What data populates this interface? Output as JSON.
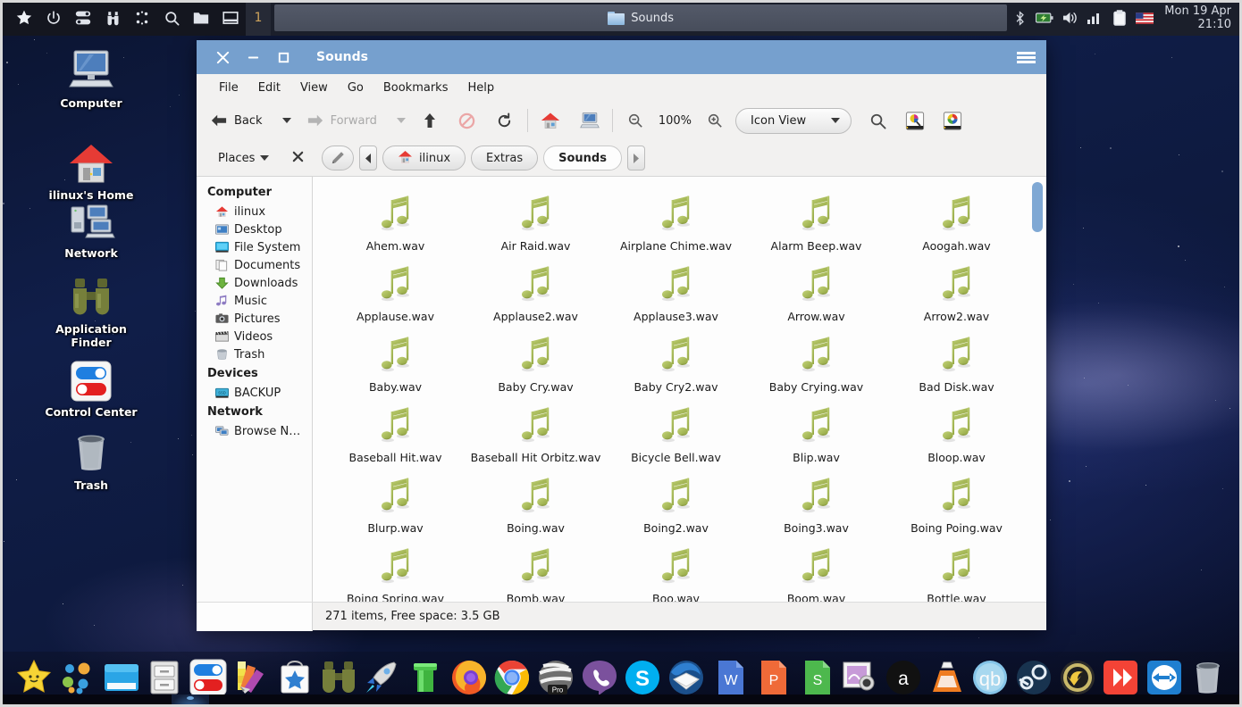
{
  "panel": {
    "launcher_icons": [
      "star-icon",
      "power-icon",
      "toggle-icon",
      "binoculars-icon",
      "apps-grid-icon",
      "search-icon",
      "folder-icon",
      "window-icon"
    ],
    "workspace": "1",
    "taskbar_window": "Sounds",
    "tray_icons": [
      "battery-icon",
      "volume-icon",
      "network-signal-icon",
      "clipboard-icon",
      "flag-us-icon"
    ],
    "clock_date": "Mon 19 Apr",
    "clock_time": "21:10"
  },
  "desktop": {
    "icons": [
      {
        "label": "Computer",
        "icon": "computer-icon"
      },
      {
        "label": "ilinux's Home",
        "icon": "home-icon"
      },
      {
        "label": "Network",
        "icon": "network-icon"
      },
      {
        "label": "Application Finder",
        "icon": "binoculars-icon"
      },
      {
        "label": "Control Center",
        "icon": "control-center-icon"
      },
      {
        "label": "Trash",
        "icon": "trash-icon"
      }
    ]
  },
  "window": {
    "title": "Sounds",
    "close_label": "✕",
    "minimize_label": "─",
    "maximize_label": "□",
    "menus": [
      "File",
      "Edit",
      "View",
      "Go",
      "Bookmarks",
      "Help"
    ],
    "toolbar": {
      "back_label": "Back",
      "forward_label": "Forward",
      "up_icon": "arrow-up-icon",
      "stop_icon": "stop-icon",
      "reload_icon": "reload-icon",
      "home_icon": "home-icon",
      "computer_icon": "computer-icon",
      "zoom_out_icon": "zoom-out-icon",
      "zoom_level": "100%",
      "zoom_in_icon": "zoom-in-icon",
      "view_mode": "Icon View",
      "search_icon": "search-icon",
      "preview_icon": "image-preview-icon",
      "colorpicker_icon": "color-wheel-icon"
    },
    "places_header": {
      "label": "Places",
      "close_icon": "close-panel-icon"
    },
    "pathbar": {
      "edit_icon": "pencil-path-icon",
      "prev_icon": "chevron-left-icon",
      "next_icon": "chevron-right-icon",
      "crumbs": [
        {
          "label": "ilinux",
          "icon": "home-icon",
          "current": false
        },
        {
          "label": "Extras",
          "icon": "",
          "current": false
        },
        {
          "label": "Sounds",
          "icon": "",
          "current": true
        }
      ]
    },
    "sidebar": {
      "groups": [
        {
          "title": "Computer",
          "items": [
            {
              "label": "ilinux",
              "icon": "home-icon"
            },
            {
              "label": "Desktop",
              "icon": "desktop-icon"
            },
            {
              "label": "File System",
              "icon": "drive-icon"
            },
            {
              "label": "Documents",
              "icon": "documents-icon"
            },
            {
              "label": "Downloads",
              "icon": "download-arrow-icon"
            },
            {
              "label": "Music",
              "icon": "music-note-icon"
            },
            {
              "label": "Pictures",
              "icon": "pictures-icon"
            },
            {
              "label": "Videos",
              "icon": "video-clapper-icon"
            },
            {
              "label": "Trash",
              "icon": "trash-icon"
            }
          ]
        },
        {
          "title": "Devices",
          "items": [
            {
              "label": "BACKUP",
              "icon": "ssd-icon"
            }
          ]
        },
        {
          "title": "Network",
          "items": [
            {
              "label": "Browse N…",
              "icon": "network-browse-icon"
            }
          ]
        }
      ]
    },
    "files": [
      "Ahem.wav",
      "Air Raid.wav",
      "Airplane Chime.wav",
      "Alarm Beep.wav",
      "Aoogah.wav",
      "Applause.wav",
      "Applause2.wav",
      "Applause3.wav",
      "Arrow.wav",
      "Arrow2.wav",
      "Baby.wav",
      "Baby Cry.wav",
      "Baby Cry2.wav",
      "Baby Crying.wav",
      "Bad Disk.wav",
      "Baseball Hit.wav",
      "Baseball Hit Orbitz.wav",
      "Bicycle Bell.wav",
      "Blip.wav",
      "Bloop.wav",
      "Blurp.wav",
      "Boing.wav",
      "Boing2.wav",
      "Boing3.wav",
      "Boing Poing.wav",
      "Boing Spring.wav",
      "Bomb.wav",
      "Boo.wav",
      "Boom.wav",
      "Bottle.wav"
    ],
    "file_icon": "music-note-icon",
    "statusbar": "271 items, Free space: 3.5 GB"
  },
  "dock": {
    "items": [
      "whisker-star-icon",
      "app-grid-icon",
      "window-manager-icon",
      "file-cabinet-icon",
      "control-center-icon",
      "color-palette-icon",
      "software-store-icon",
      "binoculars-icon",
      "rocket-icon",
      "pipe-icon",
      "firefox-icon",
      "chrome-icon",
      "opera-pro-icon",
      "viber-icon",
      "skype-icon",
      "thunderbird-icon",
      "word-icon",
      "powerpoint-icon",
      "spreadsheet-icon",
      "screenshot-icon",
      "amazon-icon",
      "vlc-icon",
      "qbittorrent-icon",
      "steam-icon",
      "undo-icon",
      "sync-icon",
      "teamviewer-icon",
      "trash-icon"
    ]
  },
  "colors": {
    "titlebar": "#76a0ce",
    "panel": "#1b1f2b",
    "accent": "#7fa8d4",
    "note": "#a3b75a"
  }
}
